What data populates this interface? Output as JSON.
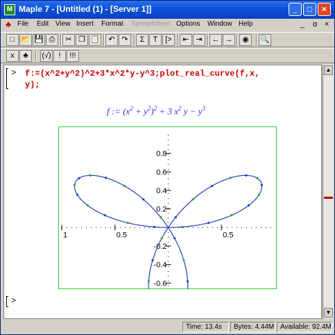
{
  "window": {
    "title": "Maple 7  - [Untitled (1) - [Server 1]]",
    "controls": [
      "_",
      "□",
      "×"
    ]
  },
  "menubar": {
    "items": [
      "File",
      "Edit",
      "View",
      "Insert",
      "Format",
      "Spreadsheet",
      "Options",
      "Window",
      "Help"
    ],
    "disabled": [
      "Spreadsheet"
    ],
    "doc_controls": [
      "_",
      "ɑ",
      "×"
    ]
  },
  "toolbar1": {
    "buttons": [
      {
        "name": "new-icon",
        "glyph": "□"
      },
      {
        "name": "open-icon",
        "glyph": "📂"
      },
      {
        "name": "save-icon",
        "glyph": "💾"
      },
      {
        "name": "print-icon",
        "glyph": "⎙"
      },
      {
        "name": "cut-icon",
        "glyph": "✂"
      },
      {
        "name": "copy-icon",
        "glyph": "❐"
      },
      {
        "name": "paste-icon",
        "glyph": "📋"
      },
      {
        "name": "undo-icon",
        "glyph": "↶"
      },
      {
        "name": "redo-icon",
        "glyph": "↷"
      },
      {
        "name": "sum-icon",
        "glyph": "Σ"
      },
      {
        "name": "text-icon",
        "glyph": "T"
      },
      {
        "name": "prompt-icon",
        "glyph": "[>"
      },
      {
        "name": "indent-left-icon",
        "glyph": "⇤"
      },
      {
        "name": "indent-right-icon",
        "glyph": "⇥"
      },
      {
        "name": "collapse-icon",
        "glyph": "←"
      },
      {
        "name": "expand-icon",
        "glyph": "→"
      },
      {
        "name": "stop-icon",
        "glyph": "◉"
      },
      {
        "name": "zoom-icon",
        "glyph": "🔍"
      }
    ]
  },
  "toolbar2": {
    "buttons": [
      {
        "name": "x-mode-icon",
        "glyph": "x"
      },
      {
        "name": "maple-leaf-icon",
        "glyph": "♣"
      },
      {
        "name": "check-syntax-icon",
        "glyph": "(√)"
      },
      {
        "name": "execute-icon",
        "glyph": "!"
      },
      {
        "name": "execute-all-icon",
        "glyph": "!!!"
      }
    ]
  },
  "worksheet": {
    "prompt": ">",
    "command_line1": "f:=(x^2+y^2)^2+3*x^2*y-y^3;plot_real_curve(f,x,",
    "command_line2": "y);",
    "output_lhs": "f := (x",
    "prompt_empty": ">"
  },
  "chart_data": {
    "type": "line",
    "title": "",
    "xlabel": "",
    "ylabel": "",
    "xlim": [
      -1,
      1
    ],
    "ylim": [
      -0.65,
      1.0
    ],
    "x_ticks": [
      {
        "value": -1,
        "label": "1"
      },
      {
        "value": -0.5,
        "label": "0.5"
      },
      {
        "value": 0.5,
        "label": "0.5"
      }
    ],
    "y_ticks": [
      {
        "value": 0.8,
        "label": "0.8"
      },
      {
        "value": 0.6,
        "label": "0.6"
      },
      {
        "value": 0.4,
        "label": "0.4"
      },
      {
        "value": 0.2,
        "label": "0.2"
      },
      {
        "value": -0.2,
        "label": "-0.2"
      },
      {
        "value": -0.4,
        "label": "-0.4"
      },
      {
        "value": -0.6,
        "label": "-0.6"
      }
    ],
    "curve": "three-leaf rose r = sin(3θ)",
    "curve_color": "#1f3fbf",
    "point_color": "#22aa22",
    "frame_color": "#33cc33"
  },
  "status": {
    "time": "Time: 13.4s",
    "bytes": "Bytes: 4.44M",
    "available": "Available: 92.4M"
  },
  "colors": {
    "title_bar": "#0a4fd6",
    "input_text": "#cc0000",
    "output_math": "#2a2aff"
  }
}
